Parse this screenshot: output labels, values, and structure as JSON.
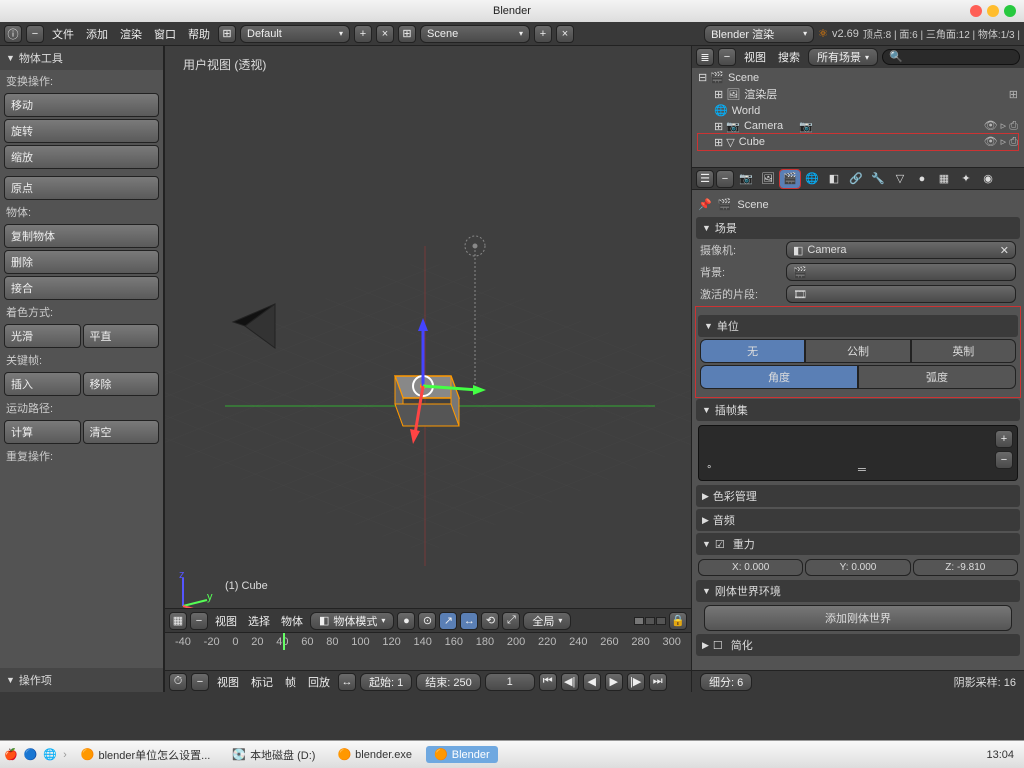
{
  "window_title": "Blender",
  "topbar": {
    "menus": [
      "文件",
      "添加",
      "渲染",
      "窗口",
      "帮助"
    ],
    "layout_name": "Default",
    "scene_name": "Scene",
    "render_engine": "Blender 渲染",
    "version": "v2.69",
    "stats": "顶点:8 | 面:6 | 三角面:12 | 物体:1/3 |"
  },
  "toolpanel": {
    "title": "物体工具",
    "transform_label": "变换操作:",
    "transform_btns": [
      "移动",
      "旋转",
      "缩放"
    ],
    "origin_btn": "原点",
    "object_label": "物体:",
    "object_btns": [
      "复制物体",
      "删除",
      "接合"
    ],
    "shading_label": "着色方式:",
    "shading_btns": [
      "光滑",
      "平直"
    ],
    "keyframes_label": "关键帧:",
    "keyframe_btns": [
      "插入",
      "移除"
    ],
    "motion_label": "运动路径:",
    "motion_btns": [
      "计算",
      "清空"
    ],
    "repeat_label": "重复操作:",
    "operator_panel": "操作项"
  },
  "viewport": {
    "label": "用户视图 (透视)",
    "object_name": "(1) Cube",
    "header_menus": [
      "视图",
      "选择",
      "物体"
    ],
    "mode": "物体模式",
    "orientation": "全局"
  },
  "timeline": {
    "ticks": [
      "-40",
      "-20",
      "0",
      "20",
      "40",
      "60",
      "80",
      "100",
      "120",
      "140",
      "160",
      "180",
      "200",
      "220",
      "240",
      "260",
      "280",
      "300"
    ],
    "menus": [
      "视图",
      "标记",
      "帧",
      "回放"
    ],
    "start_label": "起始: 1",
    "end_label": "结束: 250",
    "frame": 1
  },
  "outliner": {
    "header_menus": [
      "视图",
      "搜索"
    ],
    "filter": "所有场景",
    "items": [
      {
        "icon": "scene",
        "label": "Scene",
        "indent": 0
      },
      {
        "icon": "render",
        "label": "渲染层",
        "indent": 1
      },
      {
        "icon": "world",
        "label": "World",
        "indent": 1
      },
      {
        "icon": "camera",
        "label": "Camera",
        "indent": 1,
        "vis": true
      },
      {
        "icon": "mesh",
        "label": "Cube",
        "indent": 1,
        "vis": true,
        "hl": true
      }
    ]
  },
  "properties": {
    "context_name": "Scene",
    "scene_panel": "场景",
    "camera_label": "摄像机:",
    "camera_value": "Camera",
    "background_label": "背景:",
    "active_clip_label": "激活的片段:",
    "units_panel": "单位",
    "unit_system": [
      "无",
      "公制",
      "英制"
    ],
    "angle_units": [
      "角度",
      "弧度"
    ],
    "keying_panel": "插帧集",
    "color_mgmt": "色彩管理",
    "audio_panel": "音频",
    "gravity_panel": "重力",
    "gravity": {
      "x": "X: 0.000",
      "y": "Y: 0.000",
      "z": "Z: -9.810"
    },
    "rigidbody_panel": "刚体世界环境",
    "rigidbody_btn": "添加刚体世界",
    "simplify_panel": "简化"
  },
  "status_bar": {
    "subdiv": "细分: 6",
    "shadow": "阴影采样: 16"
  },
  "taskbar": {
    "items": [
      {
        "label": "blender单位怎么设置..."
      },
      {
        "label": "本地磁盘 (D:)"
      },
      {
        "label": "blender.exe"
      },
      {
        "label": "Blender",
        "active": true
      }
    ],
    "time": "13:04"
  }
}
